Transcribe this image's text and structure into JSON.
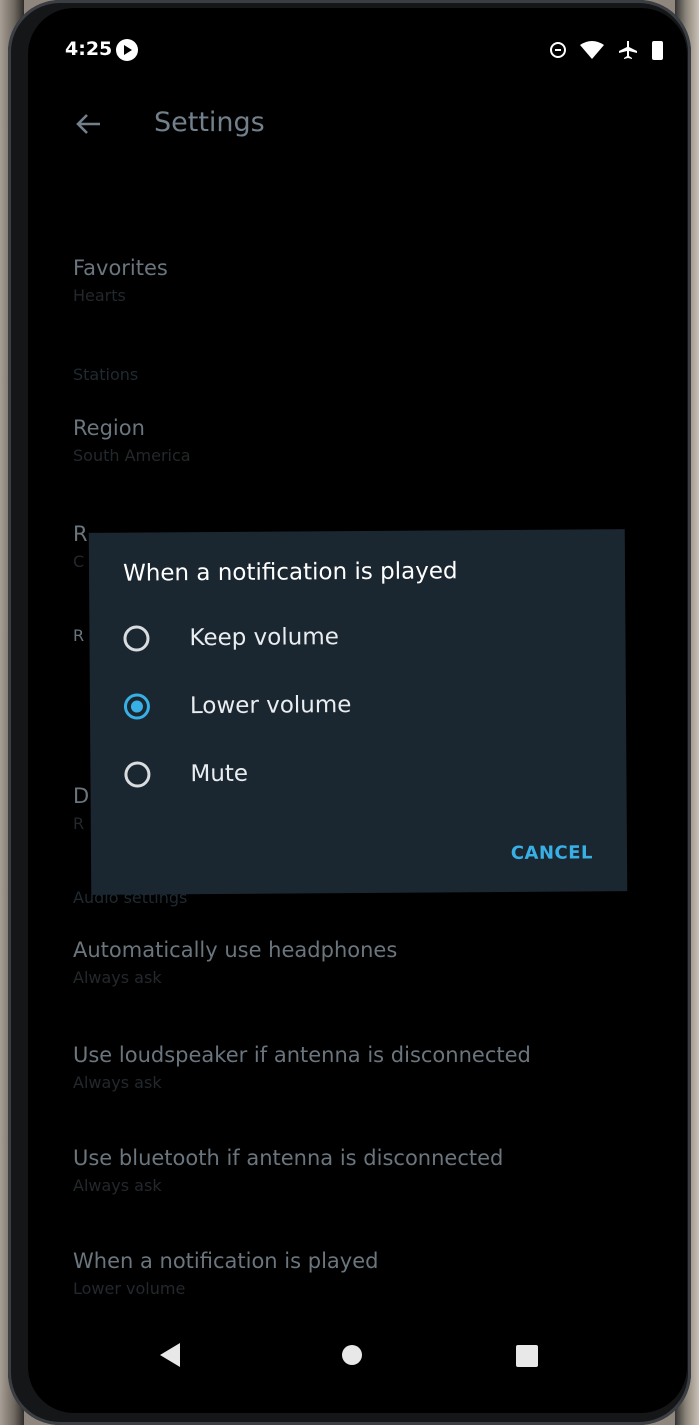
{
  "status_bar": {
    "time": "4:25"
  },
  "header": {
    "title": "Settings",
    "back_icon": "arrow-back-icon"
  },
  "settings": {
    "favorites": {
      "title": "Favorites",
      "summary": "Hearts"
    },
    "stations_header": "Stations",
    "region": {
      "title": "Region",
      "summary": "South America"
    },
    "partial_item_1": {
      "title": "R",
      "summary": "C"
    },
    "partial_item_2": {
      "title": "R"
    },
    "partial_item_3": {
      "title": "D",
      "summary": "R"
    },
    "audio_header": "Audio settings",
    "headphones": {
      "title": "Automatically use headphones",
      "summary": "Always ask"
    },
    "loudspeaker": {
      "title": "Use loudspeaker if antenna is disconnected",
      "summary": "Always ask"
    },
    "bluetooth": {
      "title": "Use bluetooth if antenna is disconnected",
      "summary": "Always ask"
    },
    "notification": {
      "title": "When a notification is played",
      "summary": "Lower volume"
    }
  },
  "dialog": {
    "title": "When a notification is played",
    "options": [
      {
        "label": "Keep volume",
        "selected": false
      },
      {
        "label": "Lower volume",
        "selected": true
      },
      {
        "label": "Mute",
        "selected": false
      }
    ],
    "cancel_label": "CANCEL"
  },
  "colors": {
    "accent": "#39b0e5",
    "dialog_background": "#1b2730"
  }
}
